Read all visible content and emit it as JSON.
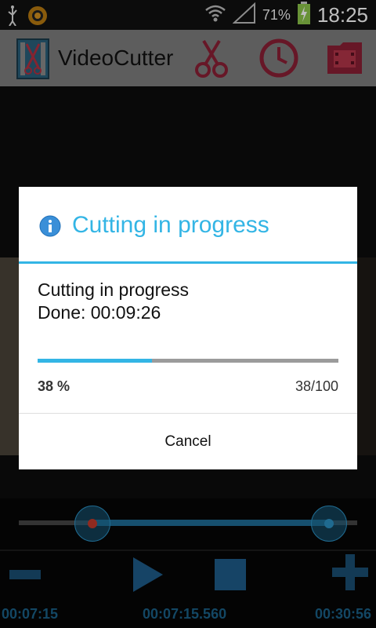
{
  "status_bar": {
    "battery_percent": "71%",
    "time": "18:25",
    "icons": [
      "usb-icon",
      "sun-icon",
      "wifi-icon",
      "signal-icon",
      "battery-charging-icon"
    ]
  },
  "action_bar": {
    "title": "VideoCutter",
    "icons": [
      "app-logo-icon",
      "scissors-icon",
      "clock-icon",
      "folder-film-icon"
    ]
  },
  "dialog": {
    "title": "Cutting in progress",
    "message_line1": "Cutting in progress",
    "message_line2": "Done: 00:09:26",
    "progress_fraction": 0.38,
    "progress_percent_label": "38 %",
    "progress_count_label": "38/100",
    "cancel_label": "Cancel"
  },
  "player": {
    "start_time": "00:07:15",
    "current_time": "00:07:15.560",
    "end_time": "00:30:56",
    "controls": [
      "minus-icon",
      "play-icon",
      "stop-icon",
      "plus-icon"
    ]
  },
  "colors": {
    "accent": "#33b5e5",
    "timecode": "#1a5f86"
  }
}
